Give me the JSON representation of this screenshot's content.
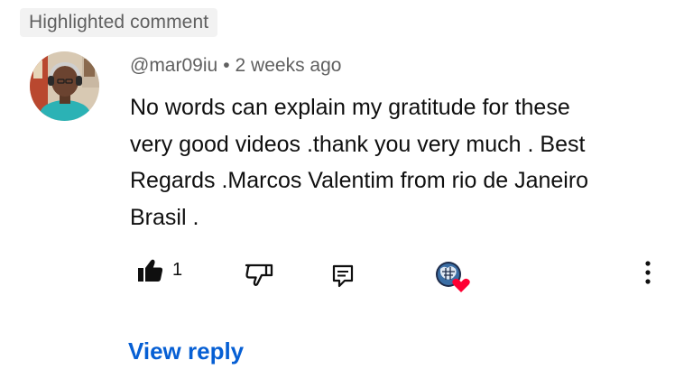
{
  "badge": {
    "label": "Highlighted comment"
  },
  "comment": {
    "author": "@mar09iu",
    "separator": "•",
    "time": "2 weeks ago",
    "text": "No words can explain my gratitude for these\nvery good videos .thank you very much . Best\nRegards .Marcos Valentim from rio de Janeiro\nBrasil ."
  },
  "actions": {
    "like_icon": "thumbs-up-filled-icon",
    "like_count": "1",
    "dislike_icon": "thumbs-down-outline-icon",
    "reply_icon": "comment-reply-icon",
    "creator_heart_icon": "creator-heart-icon",
    "more_icon": "more-vertical-icon"
  },
  "replies": {
    "view_label": "View reply"
  },
  "colors": {
    "link": "#065fd4",
    "meta": "#606060",
    "heart": "#ff0033",
    "badge_bg": "#f2f2f2"
  }
}
